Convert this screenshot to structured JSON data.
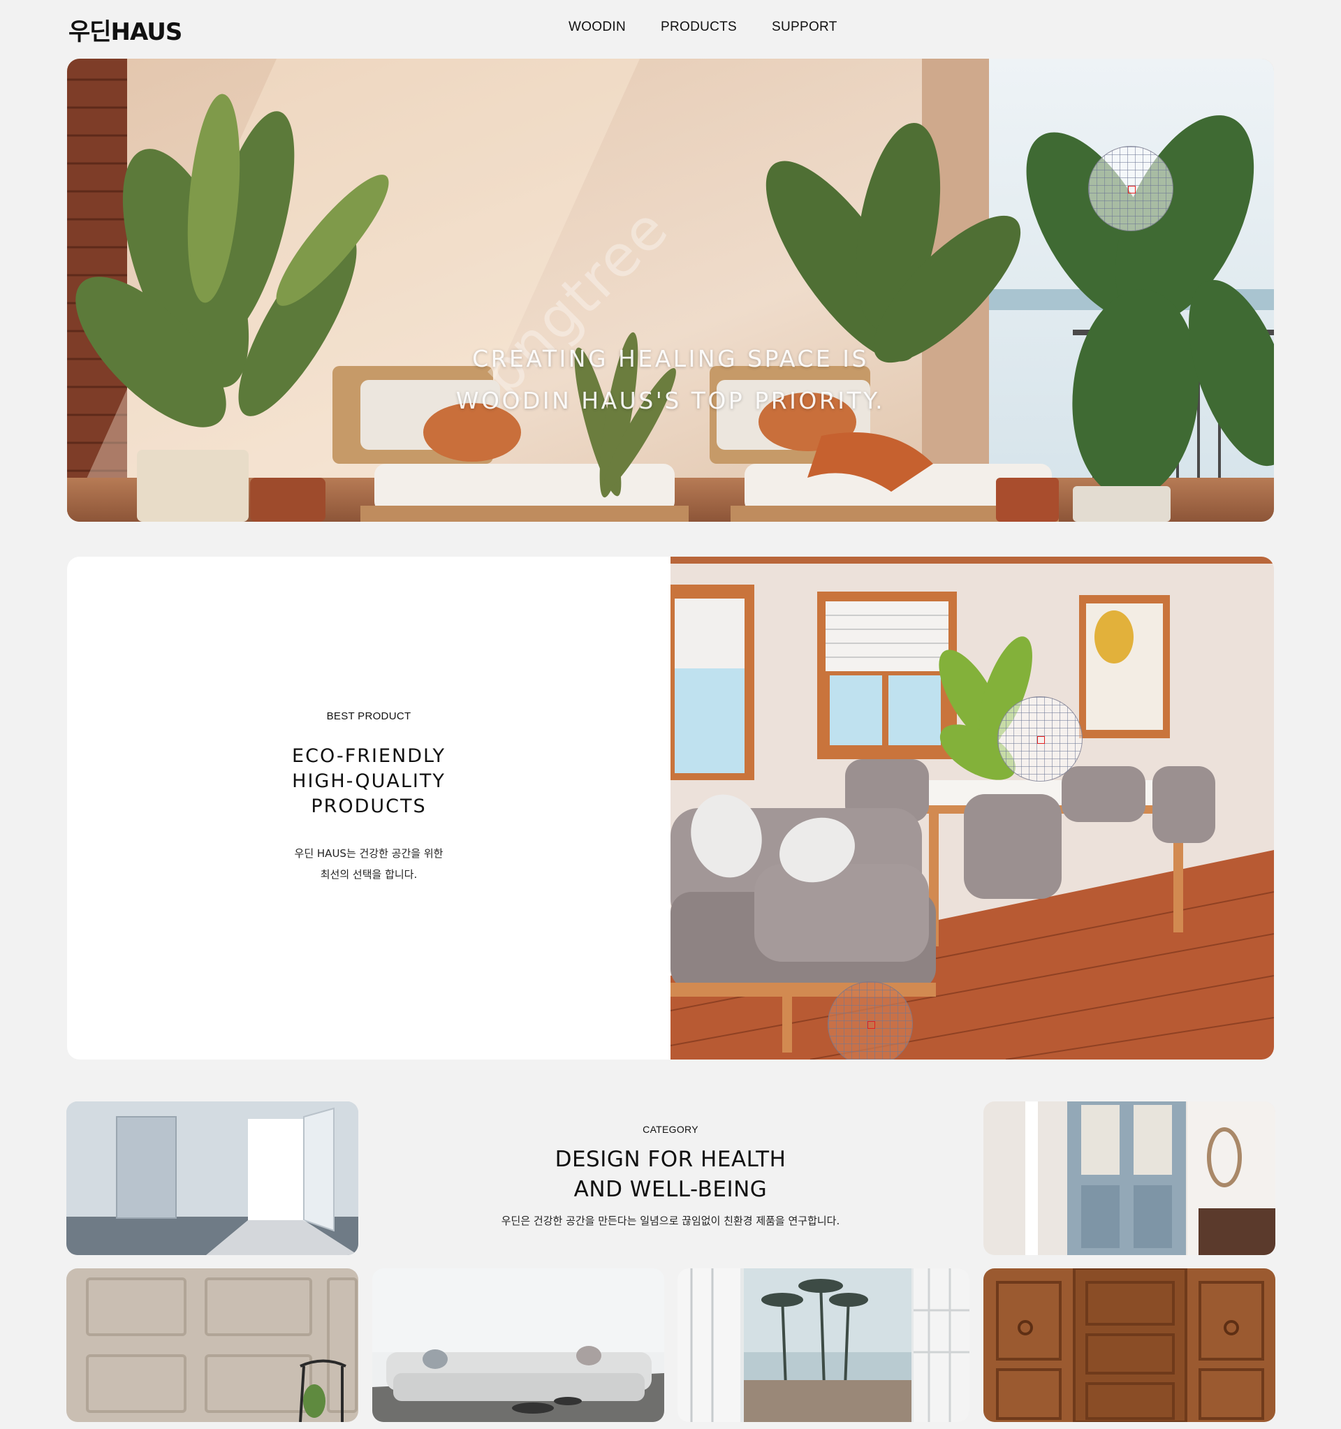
{
  "header": {
    "logo": "우딘HAUS",
    "nav": [
      "WOODIN",
      "PRODUCTS",
      "SUPPORT"
    ]
  },
  "hero": {
    "line1": "CREATING HEALING SPACE IS",
    "line2": "WOODIN HAUS'S TOP PRIORITY.",
    "watermark": "pngtree"
  },
  "best_product": {
    "eyebrow": "BEST PRODUCT",
    "title_lines": [
      "ECO-FRIENDLY",
      "HIGH-QUALITY",
      "PRODUCTS"
    ],
    "desc_lines": [
      "우딘 HAUS는 건강한 공간을 위한",
      "최선의 선택을 합니다."
    ]
  },
  "category": {
    "eyebrow": "CATEGORY",
    "title_lines": [
      "DESIGN FOR HEALTH",
      "AND WELL-BEING"
    ],
    "desc": "우딘은 건강한 공간을 만든다는 일념으로 끊임없이 친환경 제품을 연구합니다."
  },
  "colors": {
    "background": "#f2f2f2",
    "text": "#111111",
    "lens_mark": "#e21f1f"
  }
}
